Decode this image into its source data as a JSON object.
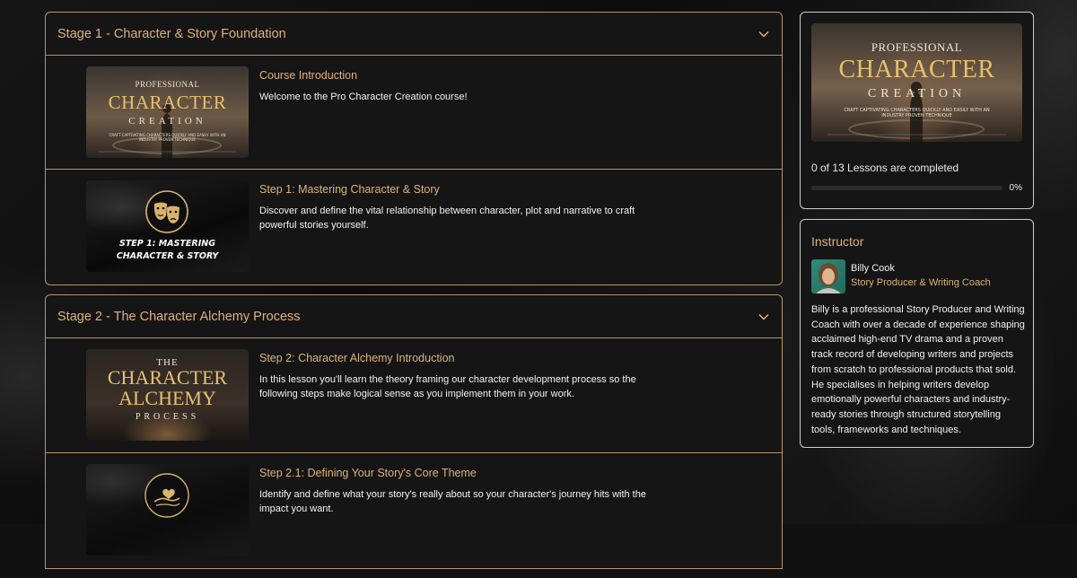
{
  "stages": [
    {
      "title": "Stage 1 - Character & Story Foundation",
      "lessons": [
        {
          "title": "Course Introduction",
          "description": "Welcome to the Pro Character Creation course!",
          "thumb": {
            "line1": "PROFESSIONAL",
            "line2": "CHARACTER",
            "line3": "CREATION",
            "tagline": "CRAFT CAPTIVATING CHARACTERS QUICKLY AND EASILY WITH AN INDUSTRY PROVEN TECHNIQUE"
          }
        },
        {
          "title": "Step 1: Mastering Character & Story",
          "description": "Discover and define the vital relationship between character, plot and narrative to craft powerful stories yourself.",
          "thumb": {
            "line1": "STEP 1: MASTERING",
            "line2": "CHARACTER & STORY",
            "icon": "theater-masks-icon"
          }
        }
      ]
    },
    {
      "title": "Stage 2 - The Character Alchemy Process",
      "lessons": [
        {
          "title": "Step 2: Character Alchemy Introduction",
          "description": "In this lesson you'll learn the theory framing our character development process so the following steps make logical sense as you implement them in your work.",
          "thumb": {
            "line1": "THE",
            "line2": "CHARACTER",
            "line3": "ALCHEMY",
            "line4": "PROCESS"
          }
        },
        {
          "title": "Step 2.1: Defining Your Story's Core Theme",
          "description": "Identify and define what your story's really about so your character's journey hits with the impact you want.",
          "thumb": {
            "icon": "hand-with-heart-icon"
          }
        }
      ]
    }
  ],
  "course": {
    "image": {
      "line1": "PROFESSIONAL",
      "line2": "CHARACTER",
      "line3": "CREATION",
      "tagline": "CRAFT CAPTIVATING CHARACTERS QUICKLY AND EASILY WITH AN INDUSTRY PROVEN TECHNIQUE"
    },
    "progress_text": "0 of 13 Lessons are completed",
    "progress_fraction": 0,
    "progress_percent": "0%"
  },
  "instructor": {
    "heading": "Instructor",
    "name": "Billy Cook",
    "role": "Story Producer & Writing Coach",
    "bio": "Billy is a professional Story Producer and Writing Coach with over a decade of experience shaping acclaimed high-end TV drama and a proven track record of developing writers and projects from scratch to professional products that sold. He specialises in helping writers develop emotionally powerful characters and industry-ready stories through structured storytelling tools, frameworks and techniques."
  },
  "colors": {
    "accent": "#e0b27c",
    "border": "#b89466",
    "panel": "#151515"
  }
}
